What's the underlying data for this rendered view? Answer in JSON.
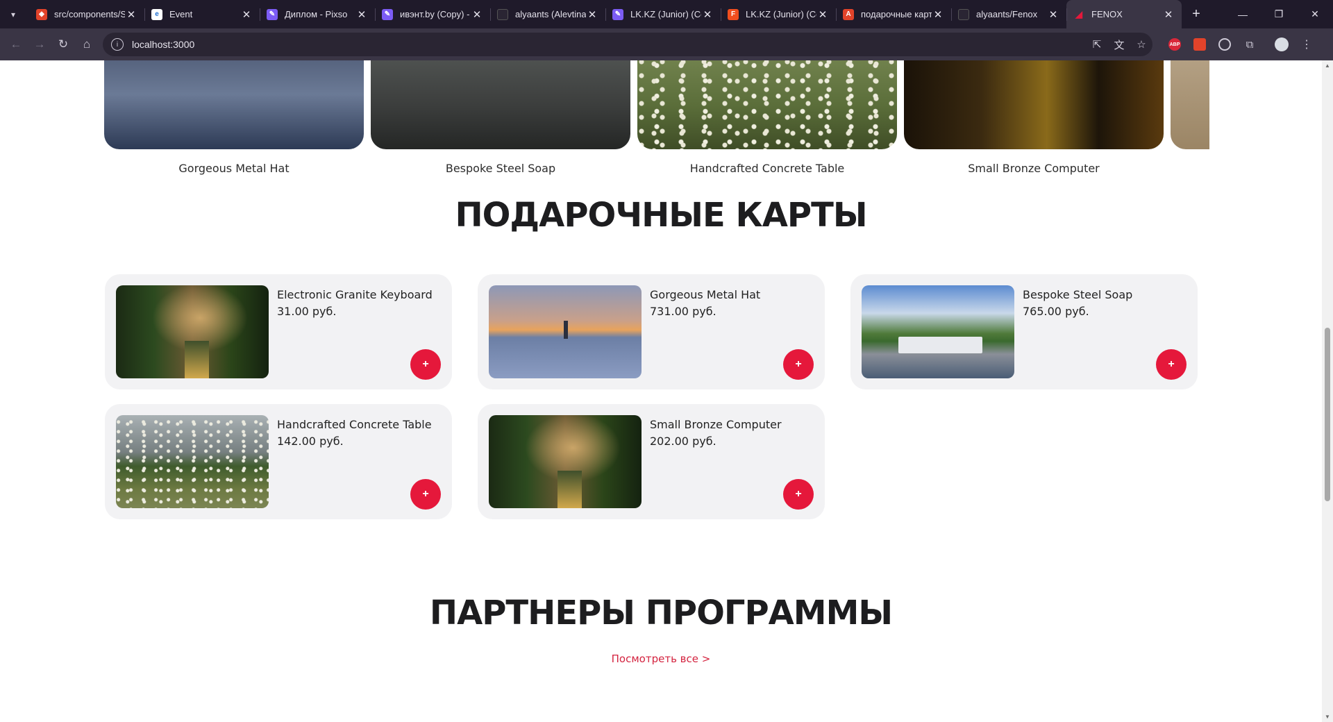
{
  "browser": {
    "tabs": [
      {
        "title": "src/components/S",
        "favicon_color": "#e2432a",
        "favicon_glyph": "gitlab-icon"
      },
      {
        "title": "Event",
        "favicon_color": "#ffffff",
        "favicon_glyph": "doc-icon"
      },
      {
        "title": "Диплом - Pixso",
        "favicon_color": "#7c5cf5",
        "favicon_glyph": "pixso-icon"
      },
      {
        "title": "ивэнт.by (Copy) -",
        "favicon_color": "#7c5cf5",
        "favicon_glyph": "pixso-icon"
      },
      {
        "title": "alyaants (Alevtina",
        "favicon_color": "#2a2533",
        "favicon_glyph": "github-icon"
      },
      {
        "title": "LK.KZ (Junior) (Co",
        "favicon_color": "#7c5cf5",
        "favicon_glyph": "pixso-icon"
      },
      {
        "title": "LK.KZ (Junior) (Co",
        "favicon_color": "#f24e1e",
        "favicon_glyph": "figma-icon"
      },
      {
        "title": "подарочные карт",
        "favicon_color": "#e2432a",
        "favicon_glyph": "apps-icon"
      },
      {
        "title": "alyaants/Fenox",
        "favicon_color": "#2a2533",
        "favicon_glyph": "github-icon"
      },
      {
        "title": "FENOX",
        "favicon_color": "#e5183b",
        "favicon_glyph": "fenox-icon",
        "active": true
      }
    ],
    "url": "localhost:3000"
  },
  "carousel": {
    "slides": [
      {
        "caption": "Gorgeous Metal Hat"
      },
      {
        "caption": "Bespoke Steel Soap"
      },
      {
        "caption": "Handcrafted Concrete Table"
      },
      {
        "caption": "Small Bronze Computer"
      },
      {
        "caption": ""
      }
    ]
  },
  "gift_cards": {
    "title": "ПОДАРОЧНЫЕ КАРТЫ",
    "items": [
      {
        "name": "Electronic Granite Keyboard",
        "price": "31.00 руб.",
        "add": "+"
      },
      {
        "name": "Gorgeous Metal Hat",
        "price": "731.00 руб.",
        "add": "+"
      },
      {
        "name": "Bespoke Steel Soap",
        "price": "765.00 руб.",
        "add": "+"
      },
      {
        "name": "Handcrafted Concrete Table",
        "price": "142.00 руб.",
        "add": "+"
      },
      {
        "name": "Small Bronze Computer",
        "price": "202.00 руб.",
        "add": "+"
      }
    ]
  },
  "partners": {
    "title": "ПАРТНЕРЫ ПРОГРАММЫ",
    "see_all": "Посмотреть все >"
  }
}
